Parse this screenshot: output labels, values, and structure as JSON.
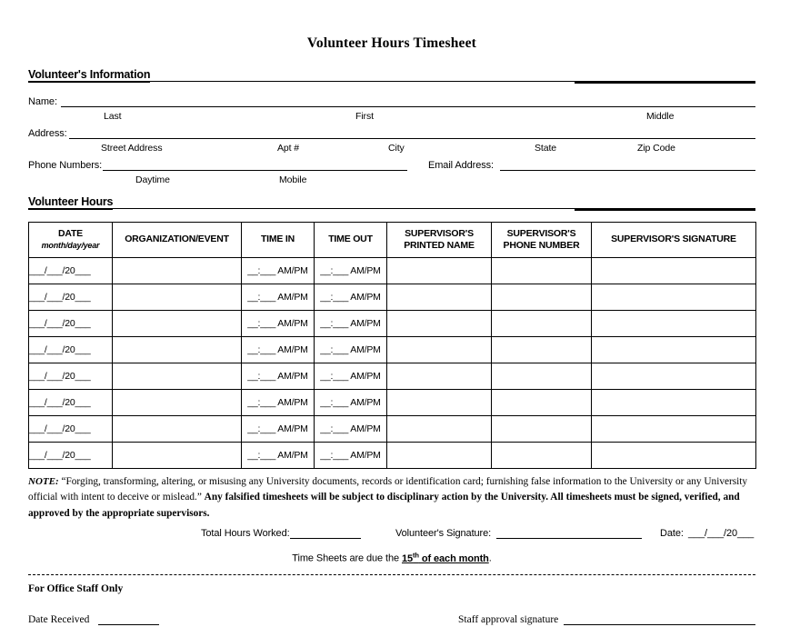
{
  "title": "Volunteer Hours Timesheet",
  "sections": {
    "volunteer_information": "Volunteer's Information",
    "volunteer_hours": "Volunteer Hours"
  },
  "info_fields": {
    "name_label": "Name:",
    "name_sub": [
      "Last",
      "First",
      "Middle"
    ],
    "address_label": "Address:",
    "address_sub": [
      "Street Address",
      "Apt #",
      "City",
      "State",
      "Zip Code"
    ],
    "phone_label": "Phone Numbers:",
    "email_label": "Email Address:",
    "phone_sub": [
      "Daytime",
      "Mobile"
    ]
  },
  "table": {
    "headers": [
      {
        "main": "DATE",
        "sub": "month/day/year"
      },
      {
        "main": "ORGANIZATION/EVENT",
        "sub": ""
      },
      {
        "main": "TIME IN",
        "sub": ""
      },
      {
        "main": "TIME OUT",
        "sub": ""
      },
      {
        "main": "SUPERVISOR'S PRINTED NAME",
        "sub": ""
      },
      {
        "main": "SUPERVISOR'S PHONE NUMBER",
        "sub": ""
      },
      {
        "main": "SUPERVISOR'S SIGNATURE",
        "sub": ""
      }
    ],
    "date_placeholder": "___/___/20___",
    "time_placeholder": "__:___ AM/PM",
    "row_count": 8
  },
  "note": {
    "lead": "NOTE:",
    "quoted": "“Forging, transforming, altering, or misusing any University documents, records or identification card; furnishing false information to the University or any University official with intent to deceive or mislead.”",
    "bold": "Any falsified timesheets will be subject to disciplinary action by the University.  All timesheets must be signed, verified, and approved by the appropriate supervisors."
  },
  "footer": {
    "total_hours_label": "Total Hours Worked:",
    "signature_label": "Volunteer's Signature:",
    "date_label": "Date:",
    "date_placeholder": "___/___/20___",
    "due_prefix": "Time Sheets are due the ",
    "due_day": "15",
    "due_sup": "th",
    "due_suffix": " of each month",
    "due_period": "."
  },
  "office": {
    "heading": "For Office Staff Only",
    "date_received_label": "Date Received",
    "staff_signature_label": "Staff approval signature"
  }
}
